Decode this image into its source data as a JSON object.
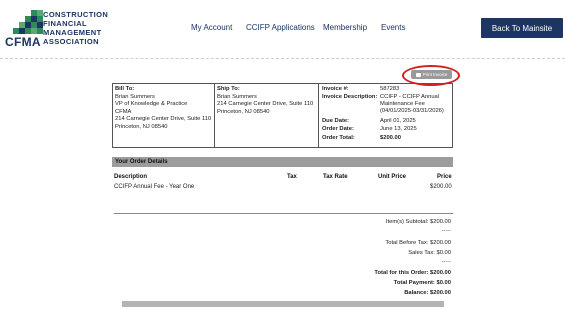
{
  "header": {
    "logo_abbr": "CFMA",
    "logo_lines": [
      "CONSTRUCTION",
      "FINANCIAL",
      "MANAGEMENT",
      "ASSOCIATION"
    ],
    "nav": [
      "My Account",
      "CCIFP Applications",
      "Membership",
      "Events"
    ],
    "back_button": "Back To Mainsite",
    "brand_color": "#1c3563",
    "logo_green": "#2e8b57"
  },
  "print_button": {
    "label": "Print Invoice",
    "highlight_color": "#d21f1f"
  },
  "invoice": {
    "bill_to": {
      "heading": "Bill To:",
      "lines": [
        "Brian Summers",
        "VP of Knowledge & Practice",
        "CFMA",
        "214 Carnegie Center Drive, Suite 110",
        "Princeton, NJ 08540"
      ]
    },
    "ship_to": {
      "heading": "Ship To:",
      "lines": [
        "Brian Summers",
        "214 Carnegie Center Drive, Suite 110",
        "Princeton, NJ 08540"
      ]
    },
    "info": {
      "invoice_no_label": "Invoice #:",
      "invoice_no": "587283",
      "description_label": "Invoice Description:",
      "description": [
        "CCIFP - CCIFP Annual",
        "Maintenance Fee",
        "(04/01/2025-03/31/2026)"
      ],
      "due_date_label": "Due Date:",
      "due_date": "April 01, 2025",
      "order_date_label": "Order Date:",
      "order_date": "June 13, 2025",
      "order_total_label": "Order Total:",
      "order_total": "$200.00"
    }
  },
  "order_details": {
    "title": "Your Order Details",
    "columns": [
      "Description",
      "Tax",
      "Tax Rate",
      "Unit Price",
      "Price"
    ],
    "items": [
      {
        "description": "CCIFP Annual Fee - Year One",
        "tax": "",
        "tax_rate": "",
        "unit_price": "",
        "price": "$200.00"
      }
    ]
  },
  "summary": {
    "subtotal_label": "Item(s) Subtotal:",
    "subtotal": "$200.00",
    "dashes": "-----",
    "total_before_tax_label": "Total Before Tax:",
    "total_before_tax": "$200.00",
    "sales_tax_label": "Sales Tax:",
    "sales_tax": "$0.00",
    "total_label": "Total for this Order:",
    "total": "$200.00",
    "payment_label": "Total Payment:",
    "payment": "$0.00",
    "balance_label": "Balance:",
    "balance": "$200.00"
  }
}
